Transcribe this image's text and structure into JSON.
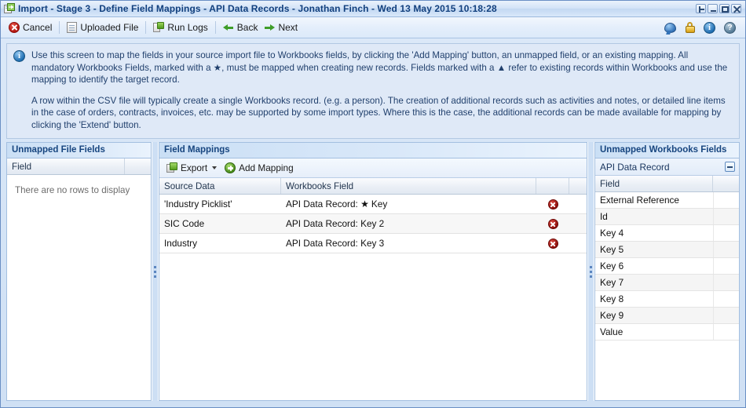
{
  "window": {
    "title": "Import - Stage 3 - Define Field Mappings - API Data Records - Jonathan Finch - Wed 13 May 2015 10:18:28",
    "icon": "import-window-icon",
    "controls": [
      {
        "name": "restore-dock-button",
        "icon": "dock-icon"
      },
      {
        "name": "minimize-button",
        "icon": "minimize-icon"
      },
      {
        "name": "maximize-button",
        "icon": "maximize-icon"
      },
      {
        "name": "close-button",
        "icon": "close-icon"
      }
    ]
  },
  "toolbar": {
    "cancel_label": "Cancel",
    "uploaded_file_label": "Uploaded File",
    "run_logs_label": "Run Logs",
    "back_label": "Back",
    "next_label": "Next",
    "right_icons": [
      {
        "name": "chat-icon",
        "title": "chat"
      },
      {
        "name": "lock-icon",
        "title": "lock"
      },
      {
        "name": "info-icon",
        "title": "info"
      },
      {
        "name": "help-icon",
        "title": "help",
        "glyph": "?"
      }
    ]
  },
  "info_panel": {
    "icon": "info-icon",
    "paragraph1": "Use this screen to map the fields in your source import file to Workbooks fields, by clicking the 'Add Mapping' button, an unmapped field, or an existing mapping. All mandatory Workbooks Fields, marked with a ★, must be mapped when creating new records. Fields marked with a ▲ refer to existing records within Workbooks and use the mapping to identify the target record.",
    "paragraph2": "A row within the CSV file will typically create a single Workbooks record. (e.g. a person). The creation of additional records such as activities and notes, or detailed line items in the case of orders, contracts, invoices, etc. may be supported by some import types. Where this is the case, the additional records can be made available for mapping by clicking the 'Extend' button."
  },
  "left_panel": {
    "title": "Unmapped File Fields",
    "column_header": "Field",
    "empty_message": "There are no rows to display"
  },
  "center_panel": {
    "title": "Field Mappings",
    "toolbar": {
      "export_label": "Export",
      "add_mapping_label": "Add Mapping"
    },
    "columns": [
      "Source Data",
      "Workbooks Field"
    ],
    "rows": [
      {
        "source": "'Industry Picklist'",
        "workbooks_field": "API Data Record: ★ Key",
        "delete_icon": "delete-icon"
      },
      {
        "source": "SIC Code",
        "workbooks_field": "API Data Record: Key 2",
        "delete_icon": "delete-icon"
      },
      {
        "source": "Industry",
        "workbooks_field": "API Data Record: Key 3",
        "delete_icon": "delete-icon"
      }
    ]
  },
  "right_panel": {
    "title": "Unmapped Workbooks Fields",
    "group_label": "API Data Record",
    "collapse_icon": "minus-icon",
    "column_header": "Field",
    "fields": [
      "External Reference",
      "Id",
      "Key 4",
      "Key 5",
      "Key 6",
      "Key 7",
      "Key 8",
      "Key 9",
      "Value"
    ]
  }
}
